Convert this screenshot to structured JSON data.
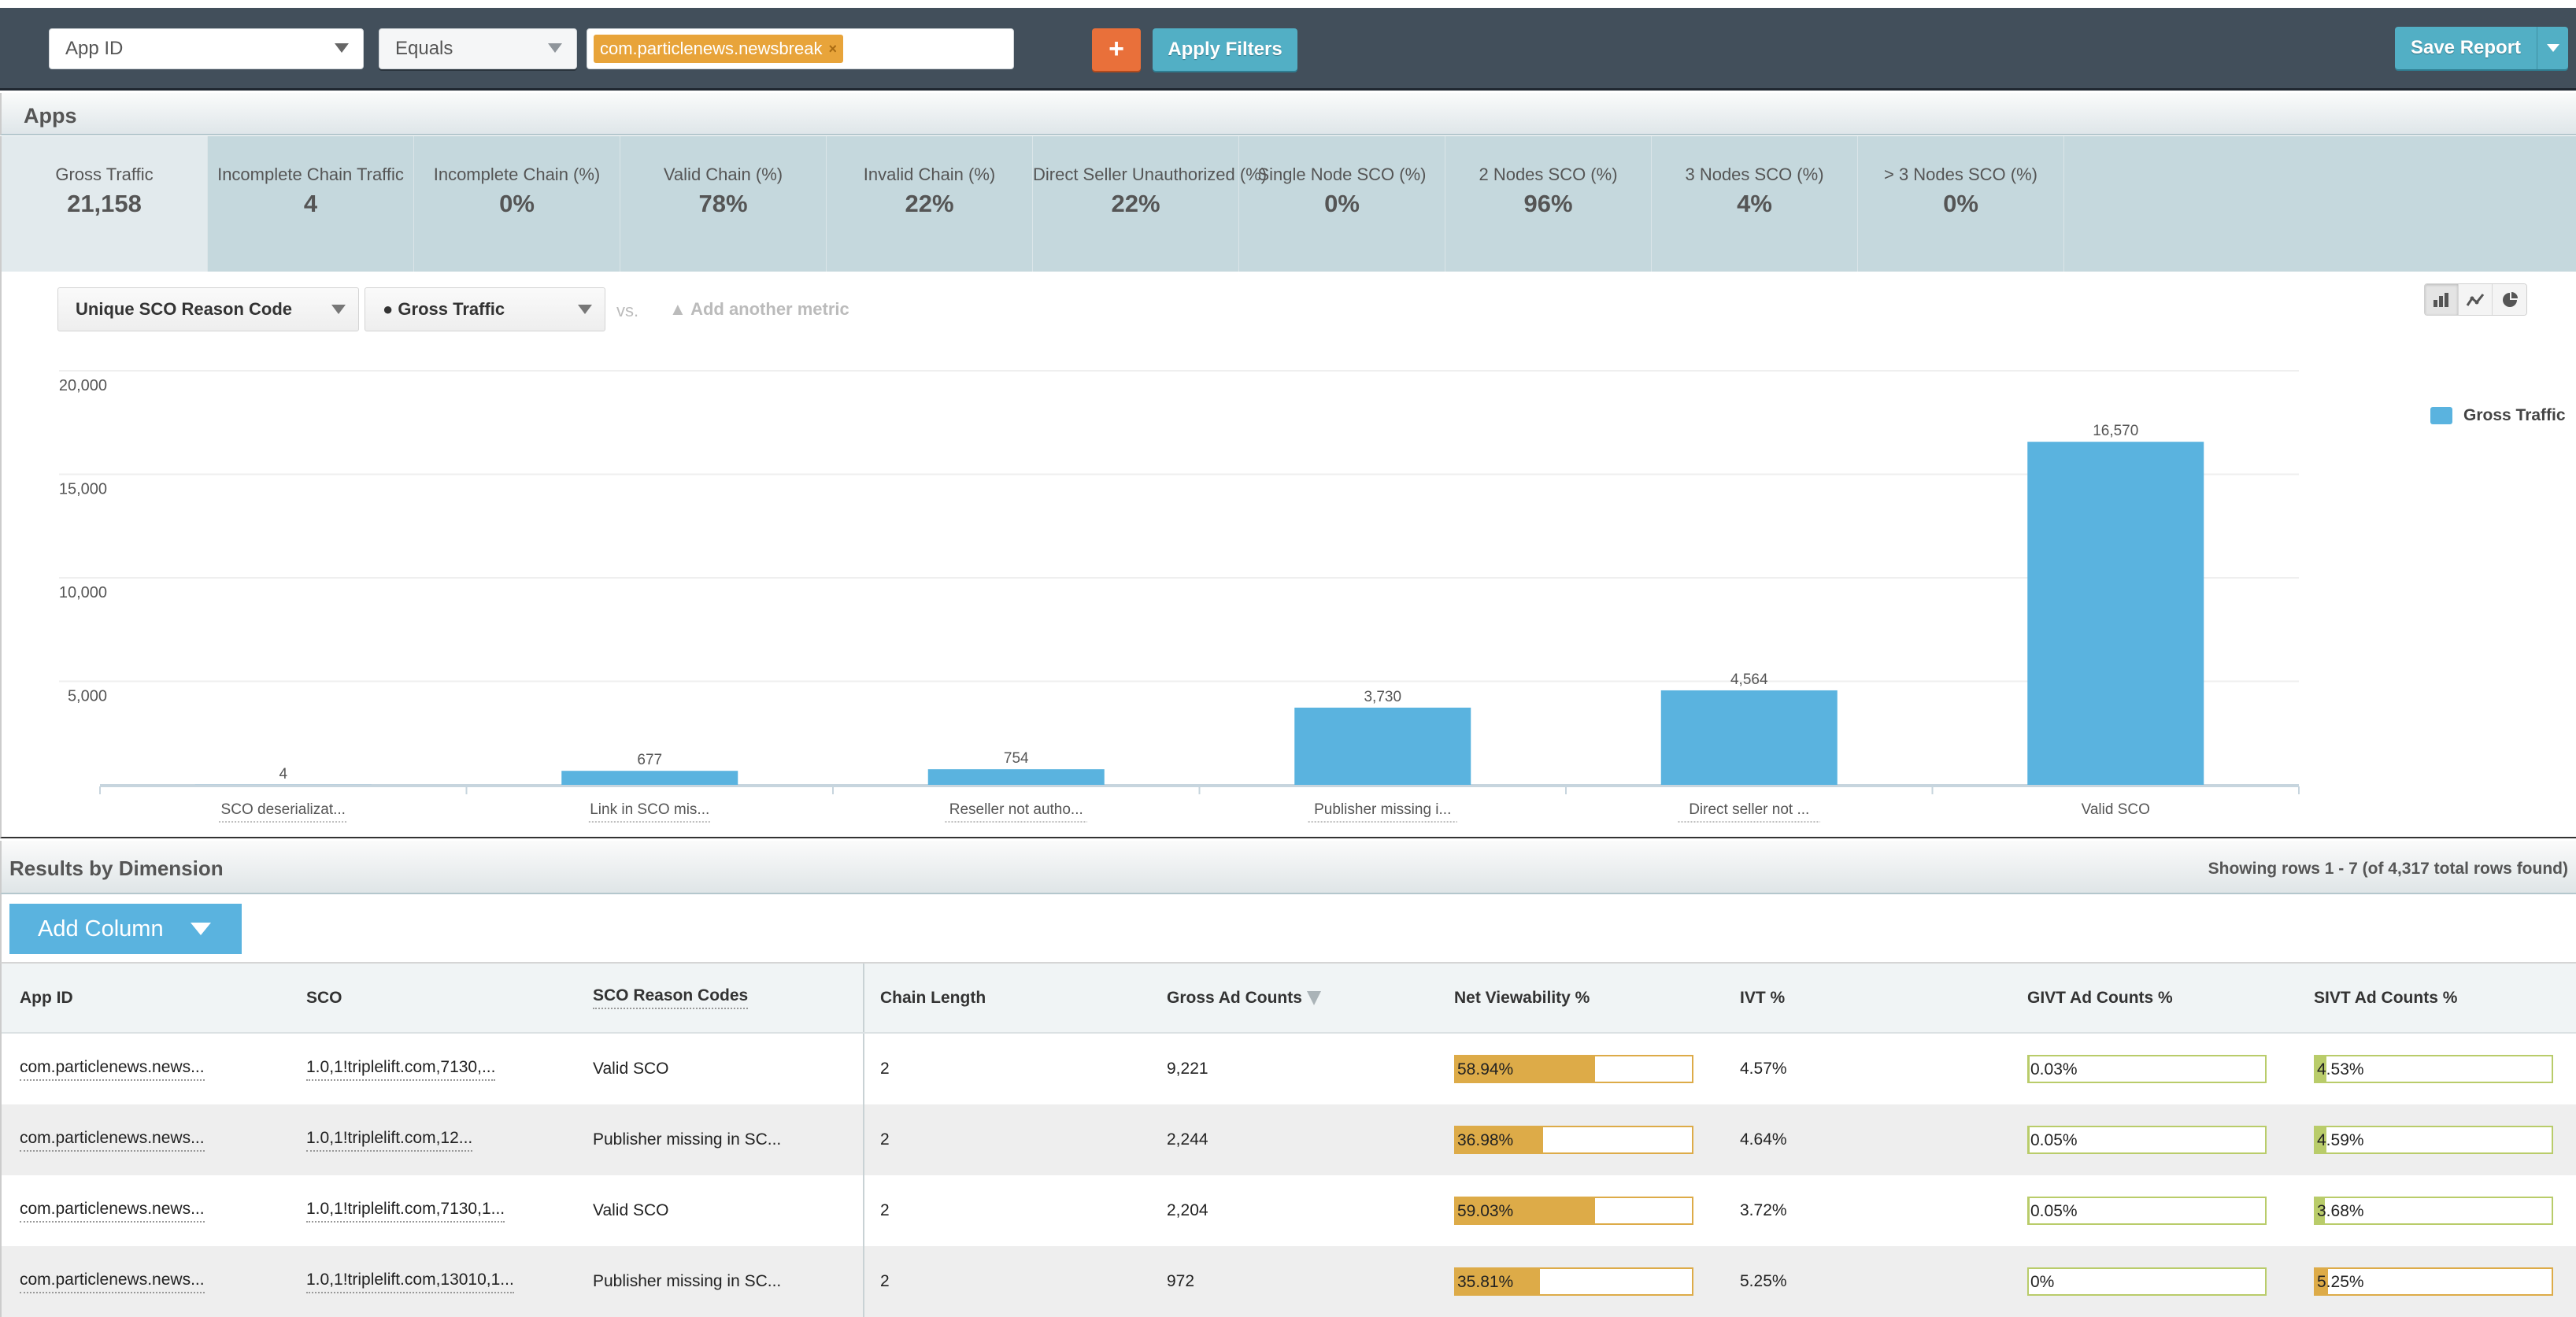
{
  "filter_bar": {
    "field": "App ID",
    "operator": "Equals",
    "values": [
      "com.particlenews.newsbreak"
    ],
    "add_filter_label": "+",
    "apply_label": "Apply Filters",
    "save_report_label": "Save Report"
  },
  "apps": {
    "title": "Apps",
    "tiles": [
      {
        "label": "Gross Traffic",
        "value": "21,158",
        "active": true
      },
      {
        "label": "Incomplete Chain Traffic",
        "value": "4"
      },
      {
        "label": "Incomplete Chain (%)",
        "value": "0%"
      },
      {
        "label": "Valid Chain (%)",
        "value": "78%"
      },
      {
        "label": "Invalid Chain (%)",
        "value": "22%"
      },
      {
        "label": "Direct Seller Unauthorized (%)",
        "value": "22%"
      },
      {
        "label": "Single Node SCO (%)",
        "value": "0%"
      },
      {
        "label": "2 Nodes SCO (%)",
        "value": "96%"
      },
      {
        "label": "3 Nodes SCO (%)",
        "value": "4%"
      },
      {
        "label": "> 3 Nodes SCO (%)",
        "value": "0%"
      }
    ]
  },
  "chart_controls": {
    "dimension": "Unique SCO Reason Code",
    "metric": "● Gross Traffic",
    "vs_label": "vs.",
    "add_metric_label": "▲ Add another metric",
    "chart_types": [
      {
        "name": "bar-chart",
        "active": true
      },
      {
        "name": "line-chart",
        "active": false
      },
      {
        "name": "pie-chart",
        "active": false
      }
    ]
  },
  "chart_data": {
    "type": "bar",
    "title": "",
    "xlabel": "",
    "ylabel": "",
    "categories": [
      "SCO deserializat...",
      "Link in SCO mis...",
      "Reseller not autho...",
      "Publisher missing i...",
      "Direct seller not ...",
      "Valid SCO"
    ],
    "series": [
      {
        "name": "Gross Traffic",
        "color": "#5ab3df",
        "values": [
          4,
          677,
          754,
          3730,
          4564,
          16570
        ]
      }
    ],
    "value_labels": [
      "4",
      "677",
      "754",
      "3,730",
      "4,564",
      "16,570"
    ],
    "yticks": [
      5000,
      10000,
      15000,
      20000
    ],
    "ytick_labels": [
      "5,000",
      "10,000",
      "15,000",
      "20,000"
    ],
    "ylim": [
      0,
      20000
    ],
    "grid": true,
    "legend": "top-right"
  },
  "results": {
    "title": "Results by Dimension",
    "rows_info": "Showing rows 1 - 7 (of 4,317 total rows found)",
    "add_column_label": "Add Column",
    "columns": [
      "App ID",
      "SCO",
      "SCO Reason Codes",
      "Chain Length",
      "Gross Ad Counts",
      "Net Viewability %",
      "IVT %",
      "GIVT Ad Counts %",
      "SIVT Ad Counts %"
    ],
    "sorted_column": "Gross Ad Counts",
    "rows": [
      {
        "app_id": "com.particlenews.news...",
        "sco": "1.0,1!triplelift.com,7130,...",
        "reason": "Valid SCO",
        "chain_length": "2",
        "gross": "9,221",
        "net_view": "58.94%",
        "net_view_frac": 0.5894,
        "ivt": "4.57%",
        "givt": "0.03%",
        "givt_frac": 0.0003,
        "sivt": "4.53%",
        "sivt_frac": 0.0453,
        "sivt_color": "green"
      },
      {
        "app_id": "com.particlenews.news...",
        "sco": "1.0,1!triplelift.com,12...",
        "reason": "Publisher missing in SC...",
        "chain_length": "2",
        "gross": "2,244",
        "net_view": "36.98%",
        "net_view_frac": 0.3698,
        "ivt": "4.64%",
        "givt": "0.05%",
        "givt_frac": 0.0005,
        "sivt": "4.59%",
        "sivt_frac": 0.0459,
        "sivt_color": "green"
      },
      {
        "app_id": "com.particlenews.news...",
        "sco": "1.0,1!triplelift.com,7130,1...",
        "reason": "Valid SCO",
        "chain_length": "2",
        "gross": "2,204",
        "net_view": "59.03%",
        "net_view_frac": 0.5903,
        "ivt": "3.72%",
        "givt": "0.05%",
        "givt_frac": 0.0005,
        "sivt": "3.68%",
        "sivt_frac": 0.0368,
        "sivt_color": "green"
      },
      {
        "app_id": "com.particlenews.news...",
        "sco": "1.0,1!triplelift.com,13010,1...",
        "reason": "Publisher missing in SC...",
        "chain_length": "2",
        "gross": "972",
        "net_view": "35.81%",
        "net_view_frac": 0.3581,
        "ivt": "5.25%",
        "givt": "0%",
        "givt_frac": 0,
        "sivt": "5.25%",
        "sivt_frac": 0.0525,
        "sivt_color": "orange"
      }
    ]
  }
}
